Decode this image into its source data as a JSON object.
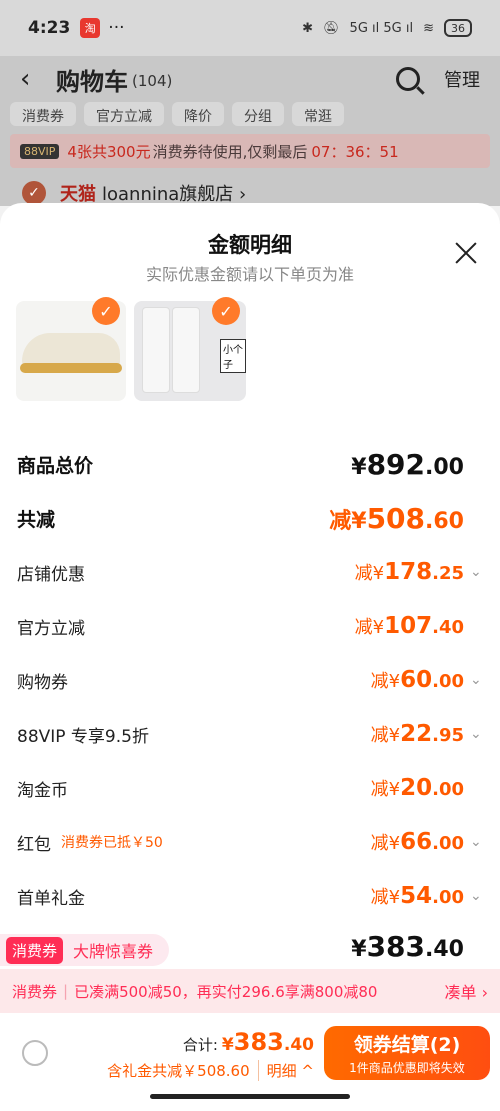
{
  "status_bar": {
    "time": "4:23",
    "app_icon_text": "淘",
    "dots": "···",
    "network": "5G ıl 5G ıl",
    "battery": "36"
  },
  "header": {
    "title": "购物车",
    "count": "(104)",
    "manage": "管理"
  },
  "filters": [
    "消费券",
    "官方立减",
    "降价",
    "分组",
    "常逛"
  ],
  "promo_banner": {
    "badge": "88VIP",
    "highlight": "4张共300元",
    "text": "消费券待使用,仅剩最后",
    "countdown": "07：36：51"
  },
  "store": {
    "tmall": "天猫",
    "name": "loannina旗舰店 ›"
  },
  "sheet": {
    "title": "金额明细",
    "subtitle": "实际优惠金额请以下单页为准",
    "thumb_pants_label": "小个子",
    "rows": [
      {
        "label": "商品总价",
        "prefix": "¥",
        "int": "892",
        "dec": ".00",
        "big": true,
        "black": true,
        "chevron": false,
        "note": ""
      },
      {
        "label": "共减",
        "prefix": "减¥",
        "int": "508",
        "dec": ".60",
        "big": true,
        "black": false,
        "chevron": false,
        "note": ""
      },
      {
        "label": "店铺优惠",
        "prefix": "减¥",
        "int": "178",
        "dec": ".25",
        "big": false,
        "black": false,
        "chevron": true,
        "note": ""
      },
      {
        "label": "官方立减",
        "prefix": "减¥",
        "int": "107",
        "dec": ".40",
        "big": false,
        "black": false,
        "chevron": false,
        "note": ""
      },
      {
        "label": "购物券",
        "prefix": "减¥",
        "int": "60",
        "dec": ".00",
        "big": false,
        "black": false,
        "chevron": true,
        "note": ""
      },
      {
        "label": "88VIP 专享9.5折",
        "prefix": "减¥",
        "int": "22",
        "dec": ".95",
        "big": false,
        "black": false,
        "chevron": true,
        "note": ""
      },
      {
        "label": "淘金币",
        "prefix": "减¥",
        "int": "20",
        "dec": ".00",
        "big": false,
        "black": false,
        "chevron": false,
        "note": ""
      },
      {
        "label": "红包",
        "prefix": "减¥",
        "int": "66",
        "dec": ".00",
        "big": false,
        "black": false,
        "chevron": true,
        "note": "消费券已抵￥50"
      },
      {
        "label": "首单礼金",
        "prefix": "减¥",
        "int": "54",
        "dec": ".00",
        "big": false,
        "black": false,
        "chevron": true,
        "note": ""
      }
    ],
    "coupon_tag": "消费券",
    "coupon_text": "大牌惊喜券",
    "total": {
      "prefix": "¥",
      "int": "383",
      "dec": ".40"
    }
  },
  "coupon_bar": {
    "label": "消费券",
    "desc": "已凑满500减50，再实付296.6享满800减80",
    "action": "凑单 ›"
  },
  "footer": {
    "total_label": "合计:",
    "total_prefix": "¥",
    "total_int": "383",
    "total_dec": ".40",
    "sub": "含礼金共减￥508.60",
    "detail": "明细 ^",
    "checkout_main": "领券结算(2)",
    "checkout_sub": "1件商品优惠即将失效"
  },
  "colors": {
    "accent": "#ff5a00",
    "coupon": "#ff2d55",
    "checkout": "#ff6a00"
  }
}
